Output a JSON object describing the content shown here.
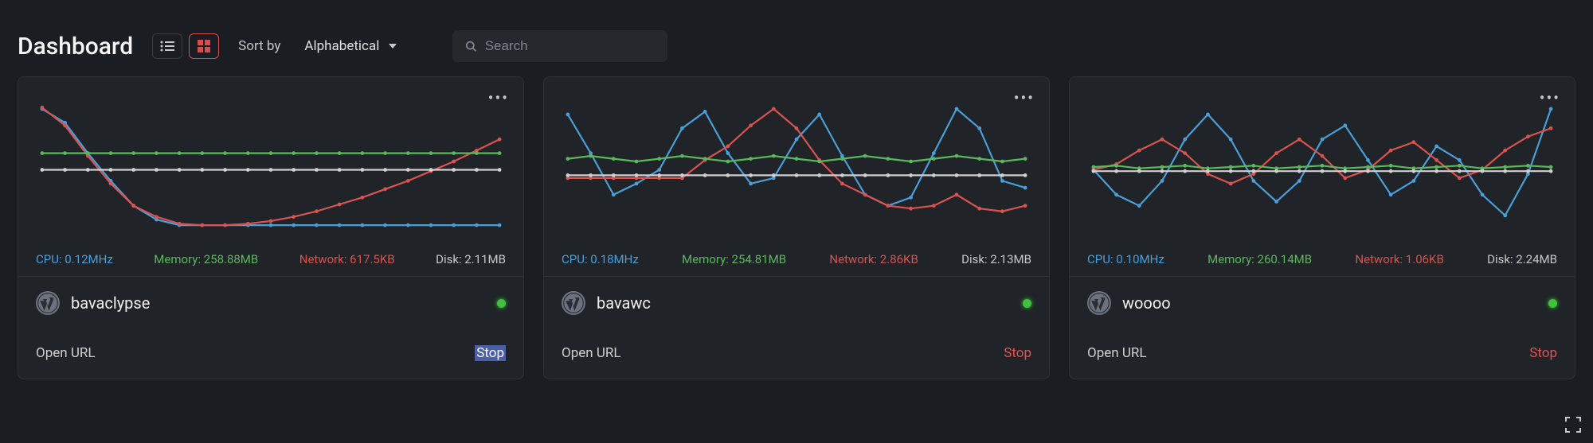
{
  "header": {
    "title": "Dashboard",
    "sort_label": "Sort by",
    "sort_value": "Alphabetical",
    "search_placeholder": "Search"
  },
  "labels": {
    "cpu": "CPU:",
    "memory": "Memory:",
    "network": "Network:",
    "disk": "Disk:",
    "open_url": "Open URL",
    "stop": "Stop"
  },
  "cards": [
    {
      "name": "bavaclypse",
      "cpu": "0.12MHz",
      "memory": "258.88MB",
      "network": "617.5KB",
      "disk": "2.11MB",
      "stop_selected": true
    },
    {
      "name": "bavawc",
      "cpu": "0.18MHz",
      "memory": "254.81MB",
      "network": "2.86KB",
      "disk": "2.13MB",
      "stop_selected": false
    },
    {
      "name": "woooo",
      "cpu": "0.10MHz",
      "memory": "260.14MB",
      "network": "1.06KB",
      "disk": "2.24MB",
      "stop_selected": false
    }
  ],
  "chart_data": [
    {
      "type": "line",
      "title": "bavaclypse resource usage",
      "x": [
        0,
        1,
        2,
        3,
        4,
        5,
        6,
        7,
        8,
        9,
        10,
        11,
        12,
        13,
        14,
        15,
        16,
        17,
        18,
        19,
        20
      ],
      "ylim": [
        0,
        100
      ],
      "series": [
        {
          "name": "CPU",
          "color": "#4a9fd9",
          "values": [
            92,
            82,
            60,
            40,
            22,
            12,
            8,
            8,
            8,
            8,
            8,
            8,
            8,
            8,
            8,
            8,
            8,
            8,
            8,
            8,
            8
          ]
        },
        {
          "name": "Network",
          "color": "#d9534f",
          "values": [
            93,
            80,
            58,
            38,
            22,
            14,
            9,
            8,
            8,
            9,
            11,
            14,
            18,
            23,
            28,
            34,
            40,
            47,
            54,
            62,
            70
          ]
        },
        {
          "name": "Memory",
          "color": "#5cb85c",
          "values": [
            60,
            60,
            60,
            60,
            60,
            60,
            60,
            60,
            60,
            60,
            60,
            60,
            60,
            60,
            60,
            60,
            60,
            60,
            60,
            60,
            60
          ]
        },
        {
          "name": "Disk",
          "color": "#d0d0d0",
          "values": [
            48,
            48,
            48,
            48,
            48,
            48,
            48,
            48,
            48,
            48,
            48,
            48,
            48,
            48,
            48,
            48,
            48,
            48,
            48,
            48,
            48
          ]
        }
      ]
    },
    {
      "type": "line",
      "title": "bavawc resource usage",
      "x": [
        0,
        1,
        2,
        3,
        4,
        5,
        6,
        7,
        8,
        9,
        10,
        11,
        12,
        13,
        14,
        15,
        16,
        17,
        18,
        19,
        20
      ],
      "ylim": [
        0,
        100
      ],
      "series": [
        {
          "name": "CPU",
          "color": "#4a9fd9",
          "values": [
            88,
            60,
            30,
            38,
            48,
            78,
            90,
            60,
            38,
            42,
            70,
            88,
            58,
            30,
            22,
            28,
            60,
            92,
            78,
            40,
            35
          ]
        },
        {
          "name": "Network",
          "color": "#d9534f",
          "values": [
            42,
            42,
            42,
            42,
            42,
            42,
            55,
            65,
            80,
            92,
            78,
            55,
            38,
            30,
            22,
            20,
            22,
            30,
            20,
            18,
            22
          ]
        },
        {
          "name": "Memory",
          "color": "#5cb85c",
          "values": [
            56,
            58,
            56,
            54,
            56,
            58,
            56,
            54,
            56,
            58,
            56,
            54,
            56,
            58,
            56,
            54,
            56,
            58,
            56,
            54,
            56
          ]
        },
        {
          "name": "Disk",
          "color": "#d0d0d0",
          "values": [
            44,
            44,
            44,
            44,
            44,
            44,
            44,
            44,
            44,
            44,
            44,
            44,
            44,
            44,
            44,
            44,
            44,
            44,
            44,
            44,
            44
          ]
        }
      ]
    },
    {
      "type": "line",
      "title": "woooo resource usage",
      "x": [
        0,
        1,
        2,
        3,
        4,
        5,
        6,
        7,
        8,
        9,
        10,
        11,
        12,
        13,
        14,
        15,
        16,
        17,
        18,
        19,
        20
      ],
      "ylim": [
        0,
        100
      ],
      "series": [
        {
          "name": "CPU",
          "color": "#4a9fd9",
          "values": [
            48,
            30,
            22,
            40,
            70,
            88,
            70,
            40,
            25,
            40,
            70,
            80,
            55,
            30,
            40,
            65,
            55,
            30,
            15,
            45,
            92
          ]
        },
        {
          "name": "Network",
          "color": "#d9534f",
          "values": [
            48,
            52,
            62,
            70,
            60,
            45,
            38,
            45,
            60,
            70,
            58,
            42,
            48,
            62,
            68,
            55,
            42,
            48,
            62,
            72,
            78
          ]
        },
        {
          "name": "Memory",
          "color": "#5cb85c",
          "values": [
            50,
            51,
            49,
            50,
            51,
            49,
            50,
            51,
            49,
            50,
            51,
            49,
            50,
            51,
            49,
            50,
            51,
            49,
            50,
            51,
            50
          ]
        },
        {
          "name": "Disk",
          "color": "#d0d0d0",
          "values": [
            47,
            47,
            47,
            47,
            47,
            47,
            47,
            47,
            47,
            47,
            47,
            47,
            47,
            47,
            47,
            47,
            47,
            47,
            47,
            47,
            47
          ]
        }
      ]
    }
  ]
}
